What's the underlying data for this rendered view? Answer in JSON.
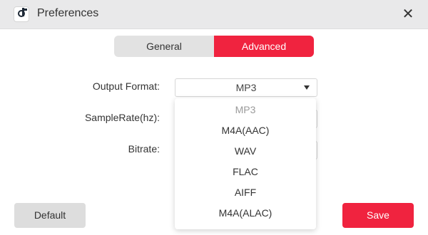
{
  "window": {
    "title": "Preferences",
    "app_icon": "music-note-icon",
    "close_icon": "close-icon",
    "close_glyph": "✕"
  },
  "tabs": [
    {
      "label": "General",
      "active": false
    },
    {
      "label": "Advanced",
      "active": true
    }
  ],
  "form": {
    "output_format_label": "Output Format:",
    "output_format_value": "MP3",
    "samplerate_label": "SampleRate(hz):",
    "bitrate_label": "Bitrate:"
  },
  "dropdown": {
    "options": [
      "MP3",
      "M4A(AAC)",
      "WAV",
      "FLAC",
      "AIFF",
      "M4A(ALAC)"
    ],
    "selected": "MP3"
  },
  "buttons": {
    "default_label": "Default",
    "save_label": "Save"
  },
  "colors": {
    "accent": "#f0233f",
    "titlebar": "#e9e9ea",
    "inactive_tab": "#e2e2e2",
    "default_button": "#dddddd"
  }
}
